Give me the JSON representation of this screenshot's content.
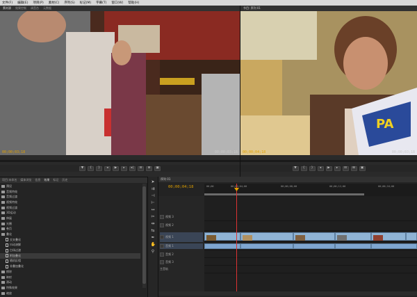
{
  "menu": [
    "文件(F)",
    "编辑(E)",
    "项目(P)",
    "素材(C)",
    "序列(S)",
    "标记(M)",
    "字幕(T)",
    "窗口(W)",
    "帮助(H)"
  ],
  "source": {
    "tabs": [
      "素材源",
      "效果控制",
      "调音台",
      "元数据"
    ],
    "timecode_in": "00;00;03;18",
    "timecode_out": "00;00;03;18"
  },
  "program": {
    "tabs": [
      "节目: 序列 01"
    ],
    "timecode_in": "00;00;04;18",
    "timecode_out": "00;00;03;18"
  },
  "project": {
    "tabs": [
      "项目:未命名",
      "媒体浏览",
      "信息",
      "效果",
      "标记",
      "历史"
    ],
    "items": [
      {
        "label": "预设",
        "kind": "folder"
      },
      {
        "label": "音频特效",
        "kind": "folder"
      },
      {
        "label": "音频过渡",
        "kind": "folder"
      },
      {
        "label": "视频特效",
        "kind": "folder"
      },
      {
        "label": "视频过渡",
        "kind": "folder"
      },
      {
        "label": "3D运动",
        "kind": "folder"
      },
      {
        "label": "伸展",
        "kind": "folder"
      },
      {
        "label": "光圈",
        "kind": "folder"
      },
      {
        "label": "卷页",
        "kind": "folder"
      },
      {
        "label": "叠化",
        "kind": "folder"
      },
      {
        "label": "交叉叠化",
        "kind": "file"
      },
      {
        "label": "抖动溶解",
        "kind": "file"
      },
      {
        "label": "白场过渡",
        "kind": "file"
      },
      {
        "label": "附加叠化",
        "kind": "file",
        "selected": true
      },
      {
        "label": "随机反相",
        "kind": "file"
      },
      {
        "label": "非叠加叠化",
        "kind": "file"
      },
      {
        "label": "擦除",
        "kind": "folder"
      },
      {
        "label": "映射",
        "kind": "folder"
      },
      {
        "label": "滑动",
        "kind": "folder"
      },
      {
        "label": "特殊效果",
        "kind": "folder"
      },
      {
        "label": "缩放",
        "kind": "folder"
      }
    ]
  },
  "timeline": {
    "tab": "序列 01",
    "timecode": "00;00;04;18",
    "ruler": [
      "00;00",
      "00;00;04;00",
      "00;00;08;00",
      "00;00;12;00",
      "00;00;16;00"
    ],
    "tracks": [
      {
        "label": "视频 3",
        "type": "video"
      },
      {
        "label": "视频 2",
        "type": "video"
      },
      {
        "label": "视频 1",
        "type": "video",
        "target": true
      },
      {
        "label": "音频 1",
        "type": "audio"
      },
      {
        "label": "音频 2",
        "type": "audio"
      },
      {
        "label": "音频 3",
        "type": "audio"
      },
      {
        "label": "主音轨",
        "type": "master"
      }
    ]
  }
}
